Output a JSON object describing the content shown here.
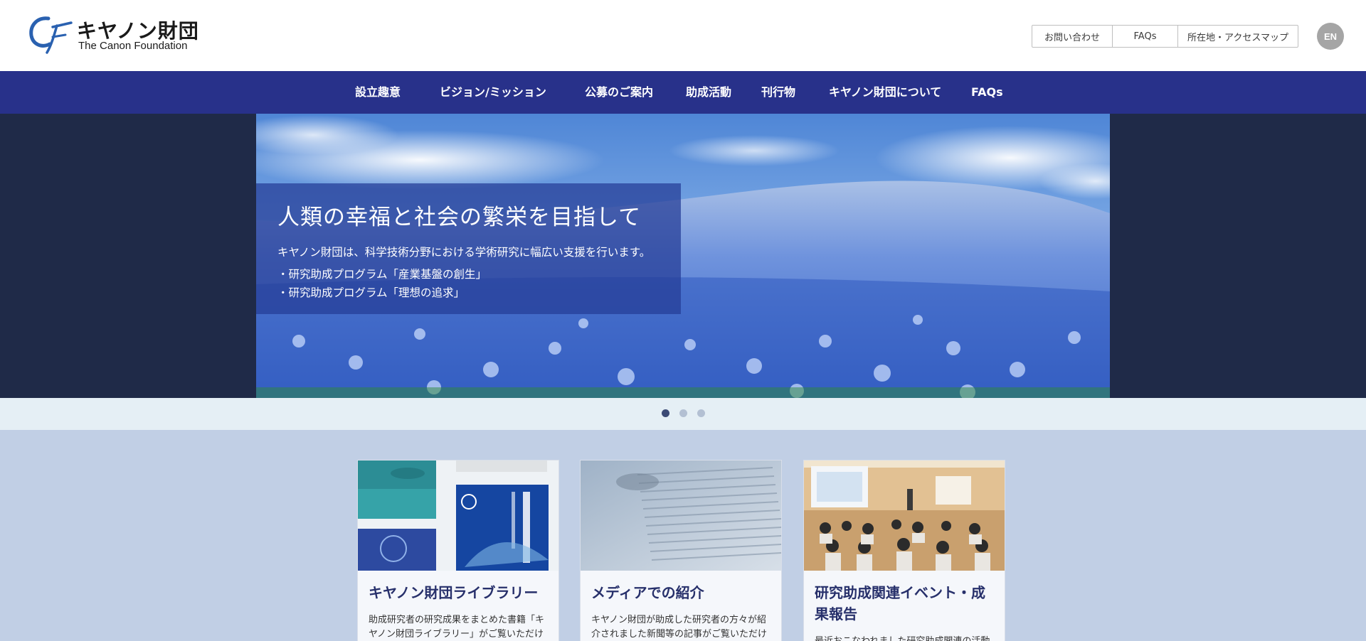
{
  "header": {
    "logo_ja": "キヤノン財団",
    "logo_en": "The Canon Foundation",
    "utility_links": [
      "お問い合わせ",
      "FAQs",
      "所在地・アクセスマップ"
    ],
    "lang": "EN"
  },
  "nav": {
    "items": [
      "設立趣意",
      "ビジョン/ミッション",
      "公募のご案内",
      "助成活動",
      "刊行物",
      "キヤノン財団について",
      "FAQs"
    ]
  },
  "hero": {
    "title": "人類の幸福と社会の繁栄を目指して",
    "lead": "キヤノン財団は、科学技術分野における学術研究に幅広い支援を行います。",
    "items": [
      "・研究助成プログラム「産業基盤の創生」",
      "・研究助成プログラム「理想の追求」"
    ],
    "slide_count": 3,
    "active_slide": 1
  },
  "cards": [
    {
      "title": "キヤノン財団ライブラリー",
      "text": "助成研究者の研究成果をまとめた書籍「キヤノン財団ライブラリー」がご覧いただけ"
    },
    {
      "title": "メディアでの紹介",
      "text": "キヤノン財団が助成した研究者の方々が紹介されました新聞等の記事がご覧いただけ"
    },
    {
      "title": "研究助成関連イベント・成果報告",
      "text": "最近おこなわれました研究助成関連の活動"
    }
  ],
  "colors": {
    "nav_bg": "#28318a",
    "hero_bg": "#1f2a48",
    "caption_bg": "#243c96",
    "page_bg": "#c1cfe5",
    "card_title": "#27306b"
  }
}
